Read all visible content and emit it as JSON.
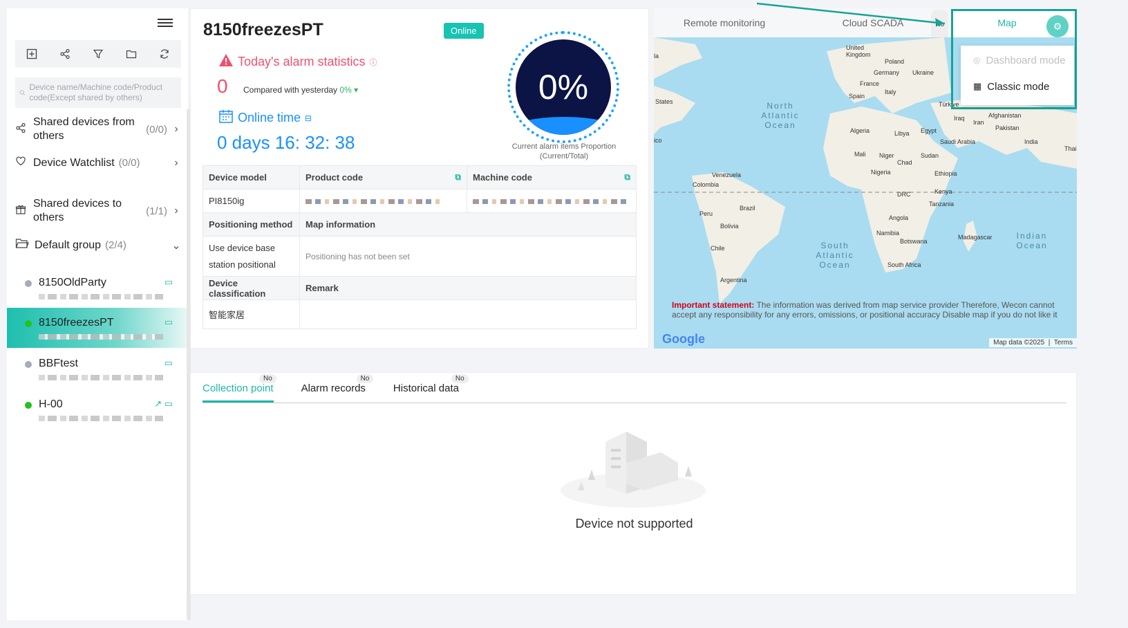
{
  "sidebar": {
    "search_placeholder": "Device name/Machine code/Product code(Except shared by others)",
    "menu": [
      {
        "label": "Shared devices from others",
        "count": "(0/0)"
      },
      {
        "label": "Device Watchlist",
        "count": "(0/0)"
      },
      {
        "label": "Shared devices to others",
        "count": "(1/1)"
      },
      {
        "label": "Default group",
        "count": "(2/4)"
      }
    ],
    "devices": [
      {
        "name": "8150OldParty",
        "status": "offline"
      },
      {
        "name": "8150freezesPT",
        "status": "online"
      },
      {
        "name": "BBFtest",
        "status": "offline"
      },
      {
        "name": "H-00",
        "status": "online"
      }
    ]
  },
  "device": {
    "title": "8150freezesPT",
    "status_badge": "Online",
    "alarm_title": "Today's alarm statistics",
    "alarm_count": "0",
    "compare_text": "Compared with yesterday",
    "compare_pct": "0%",
    "online_title": "Online time",
    "online_value": "0 days 16: 32: 38",
    "gauge_value": "0%",
    "gauge_caption": "Current alarm items Proportion (Current/Total)",
    "table": {
      "h_model": "Device model",
      "h_product": "Product code",
      "h_machine": "Machine code",
      "model": "PI8150ig",
      "h_positioning": "Positioning method",
      "h_mapinfo": "Map information",
      "positioning": "Use device base station positional",
      "mapinfo": "Positioning has not been set",
      "h_class": "Device classification",
      "h_remark": "Remark",
      "classification": "智能家居",
      "remark": ""
    }
  },
  "map": {
    "tabs": [
      "Remote monitoring",
      "Cloud SCADA",
      "Map"
    ],
    "no_badge": "No",
    "dropdown": [
      "Dashboard mode",
      "Classic mode"
    ],
    "labels": {
      "north_atlantic": "North Atlantic Ocean",
      "south_atlantic": "South Atlantic Ocean",
      "indian": "Indian Ocean"
    },
    "places": [
      "United Kingdom",
      "Poland",
      "Germany",
      "Ukraine",
      "France",
      "Italy",
      "Spain",
      "Türkiye",
      "Iraq",
      "Iran",
      "Afghanistan",
      "Pakistan",
      "India",
      "Thai",
      "Algeria",
      "Libya",
      "Egypt",
      "Saudi Arabia",
      "Mali",
      "Niger",
      "Chad",
      "Sudan",
      "Nigeria",
      "Ethiopia",
      "Kenya",
      "DRC",
      "Tanzania",
      "Angola",
      "Namibia",
      "Botswana",
      "Madagascar",
      "South Africa",
      "Venezuela",
      "Colombia",
      "Peru",
      "Brazil",
      "Bolivia",
      "Chile",
      "Argentina",
      "States",
      "ico",
      "la"
    ],
    "statement_label": "Important statement:",
    "statement_text": "The information was derived from map service provider Therefore, Wecon cannot accept any responsibility for any errors, omissions, or positional accuracy Disable map if you do not like it",
    "google": "Google",
    "mapdata": "Map data ©2025",
    "terms": "Terms"
  },
  "bottom": {
    "tabs": [
      "Collection point",
      "Alarm records",
      "Historical data"
    ],
    "no_badge": "No",
    "empty_text": "Device not supported"
  },
  "colors": {
    "accent": "#1fb8a6",
    "alarm": "#f0506e",
    "online_time": "#1890ff",
    "online_dot": "#1ec51e",
    "offline_dot": "#a6acbd"
  }
}
